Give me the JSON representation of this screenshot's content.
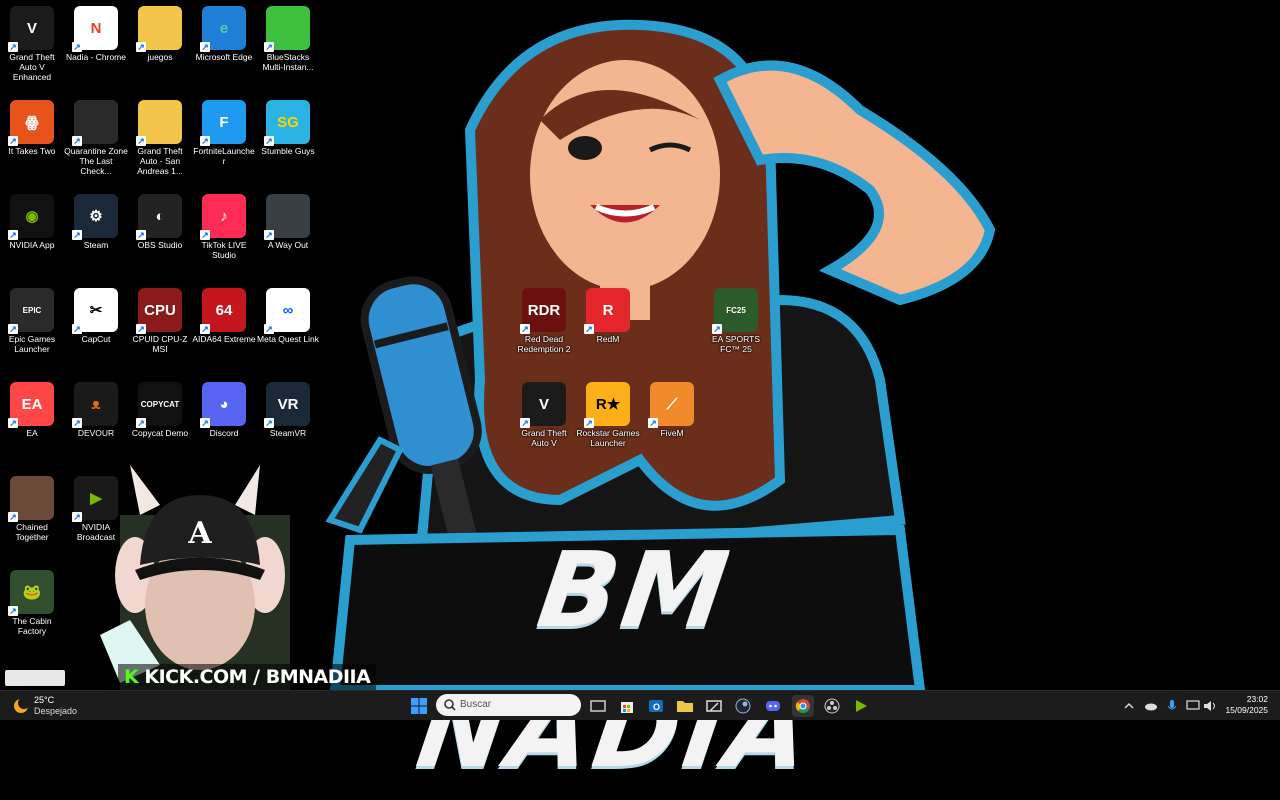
{
  "wallpaper": {
    "banner_text": "BM NADIA"
  },
  "desktop_icons": [
    {
      "id": "gta5-enhanced",
      "label": "Grand Theft Auto V Enhanced",
      "glyph": "V",
      "bg": "#1b1b1b",
      "fg": "#ffffff",
      "icon": "gta-v-icon"
    },
    {
      "id": "nadia-chrome",
      "label": "Nadia - Chrome",
      "glyph": "N",
      "bg": "#ffffff",
      "fg": "#db4437",
      "icon": "chrome-icon"
    },
    {
      "id": "juegos",
      "label": "juegos",
      "glyph": "",
      "bg": "#f3c54a",
      "fg": "#000000",
      "icon": "folder-icon"
    },
    {
      "id": "edge",
      "label": "Microsoft Edge",
      "glyph": "e",
      "bg": "#1f7fd6",
      "fg": "#49d3a0",
      "icon": "edge-icon"
    },
    {
      "id": "bluestacks",
      "label": "BlueStacks Multi-Instan...",
      "glyph": "",
      "bg": "#3ec13e",
      "fg": "#ffffff",
      "icon": "bluestacks-icon"
    },
    {
      "id": "ittakestwo",
      "label": "It Takes Two",
      "glyph": "ꙮ",
      "bg": "#e8531c",
      "fg": "#ffffff",
      "icon": "it-takes-two-icon"
    },
    {
      "id": "quarantine",
      "label": "Quarantine Zone The Last Check...",
      "glyph": "",
      "bg": "#2a2a2a",
      "fg": "#cccccc",
      "icon": "quarantine-zone-icon"
    },
    {
      "id": "gta-sa",
      "label": "Grand Theft Auto - San Andreas 1...",
      "glyph": "",
      "bg": "#f3c54a",
      "fg": "#000000",
      "icon": "folder-icon"
    },
    {
      "id": "fortnite",
      "label": "FortniteLauncher",
      "glyph": "F",
      "bg": "#1e9bf0",
      "fg": "#ffffff",
      "icon": "fortnite-icon"
    },
    {
      "id": "stumble",
      "label": "Stumble Guys",
      "glyph": "SG",
      "bg": "#2bb3e6",
      "fg": "#ffd400",
      "icon": "stumble-guys-icon"
    },
    {
      "id": "nvidia-app",
      "label": "NVIDIA App",
      "glyph": "◉",
      "bg": "#111111",
      "fg": "#76b900",
      "icon": "nvidia-icon"
    },
    {
      "id": "steam",
      "label": "Steam",
      "glyph": "⚙",
      "bg": "#1b2838",
      "fg": "#ffffff",
      "icon": "steam-icon"
    },
    {
      "id": "obs",
      "label": "OBS Studio",
      "glyph": "◐",
      "bg": "#222222",
      "fg": "#ffffff",
      "icon": "obs-icon"
    },
    {
      "id": "tiktok",
      "label": "TikTok LIVE Studio",
      "glyph": "♪",
      "bg": "#fe2c55",
      "fg": "#ffffff",
      "icon": "tiktok-icon"
    },
    {
      "id": "awayout",
      "label": "A Way Out",
      "glyph": "",
      "bg": "#3a3f44",
      "fg": "#ffffff",
      "icon": "a-way-out-icon"
    },
    {
      "id": "epic",
      "label": "Epic Games Launcher",
      "glyph": "EPIC",
      "bg": "#2a2a2a",
      "fg": "#ffffff",
      "icon": "epic-games-icon"
    },
    {
      "id": "capcut",
      "label": "CapCut",
      "glyph": "✂",
      "bg": "#ffffff",
      "fg": "#000000",
      "icon": "capcut-icon"
    },
    {
      "id": "cpuz",
      "label": "CPUID CPU-Z MSI",
      "glyph": "CPU",
      "bg": "#8b1a1a",
      "fg": "#ffffff",
      "icon": "cpu-z-icon"
    },
    {
      "id": "aida64",
      "label": "AIDA64 Extreme",
      "glyph": "64",
      "bg": "#c4161c",
      "fg": "#ffffff",
      "icon": "aida64-icon"
    },
    {
      "id": "metaquest",
      "label": "Meta Quest Link",
      "glyph": "∞",
      "bg": "#ffffff",
      "fg": "#0866ff",
      "icon": "meta-icon"
    },
    {
      "id": "ea",
      "label": "EA",
      "glyph": "EA",
      "bg": "#ff4747",
      "fg": "#ffffff",
      "icon": "ea-icon"
    },
    {
      "id": "devour",
      "label": "DEVOUR",
      "glyph": "ᴥ",
      "bg": "#1a1a1a",
      "fg": "#e06a1a",
      "icon": "devour-icon"
    },
    {
      "id": "copycat",
      "label": "Copycat Demo",
      "glyph": "COPYCAT",
      "bg": "#111111",
      "fg": "#ffffff",
      "icon": "copycat-icon"
    },
    {
      "id": "discord",
      "label": "Discord",
      "glyph": "◕",
      "bg": "#5865f2",
      "fg": "#ffffff",
      "icon": "discord-icon"
    },
    {
      "id": "steamvr",
      "label": "SteamVR",
      "glyph": "VR",
      "bg": "#1b2838",
      "fg": "#ffffff",
      "icon": "steamvr-icon"
    },
    {
      "id": "chained",
      "label": "Chained Together",
      "glyph": "",
      "bg": "#6b4a3a",
      "fg": "#ffffff",
      "icon": "chained-together-icon"
    },
    {
      "id": "nvidia-broadcast",
      "label": "NVIDIA Broadcast",
      "glyph": "▶",
      "bg": "#1a1a1a",
      "fg": "#76b900",
      "icon": "nvidia-broadcast-icon"
    },
    {
      "id": "cabin",
      "label": "The Cabin Factory",
      "glyph": "🐸",
      "bg": "#2f4f2f",
      "fg": "#7fd17f",
      "icon": "cabin-factory-icon"
    },
    {
      "id": "rdr2",
      "label": "Red Dead Redemption 2",
      "glyph": "RDR",
      "bg": "#6b0f0f",
      "fg": "#ffffff",
      "icon": "rdr2-icon"
    },
    {
      "id": "redm",
      "label": "RedM",
      "glyph": "R",
      "bg": "#e3262c",
      "fg": "#ffffff",
      "icon": "redm-icon"
    },
    {
      "id": "fc25",
      "label": "EA SPORTS FC™ 25",
      "glyph": "FC25",
      "bg": "#2b5a2b",
      "fg": "#ffffff",
      "icon": "ea-fc25-icon"
    },
    {
      "id": "gta5",
      "label": "Grand Theft Auto V",
      "glyph": "V",
      "bg": "#1b1b1b",
      "fg": "#ffffff",
      "icon": "gta-v-icon"
    },
    {
      "id": "rockstar",
      "label": "Rockstar Games Launcher",
      "glyph": "R★",
      "bg": "#fcaf17",
      "fg": "#000000",
      "icon": "rockstar-icon"
    },
    {
      "id": "fivem",
      "label": "FiveM",
      "glyph": "⟋",
      "bg": "#f18a2b",
      "fg": "#ffffff",
      "icon": "fivem-icon"
    }
  ],
  "webcam": {
    "overlay_text_k": "K",
    "overlay_text": "KICK.COM / BMNADIIA"
  },
  "taskbar": {
    "weather_temp": "25°C",
    "weather_desc": "Despejado",
    "search_placeholder": "Buscar",
    "time": "23:02",
    "date": "15/09/2025",
    "pinned": [
      "windows-start-icon",
      "task-view-icon",
      "store-icon",
      "outlook-icon",
      "file-explorer-icon",
      "snipping-icon",
      "steam-icon",
      "discord-icon",
      "chrome-icon",
      "obs-icon",
      "nvidia-broadcast-icon"
    ]
  }
}
